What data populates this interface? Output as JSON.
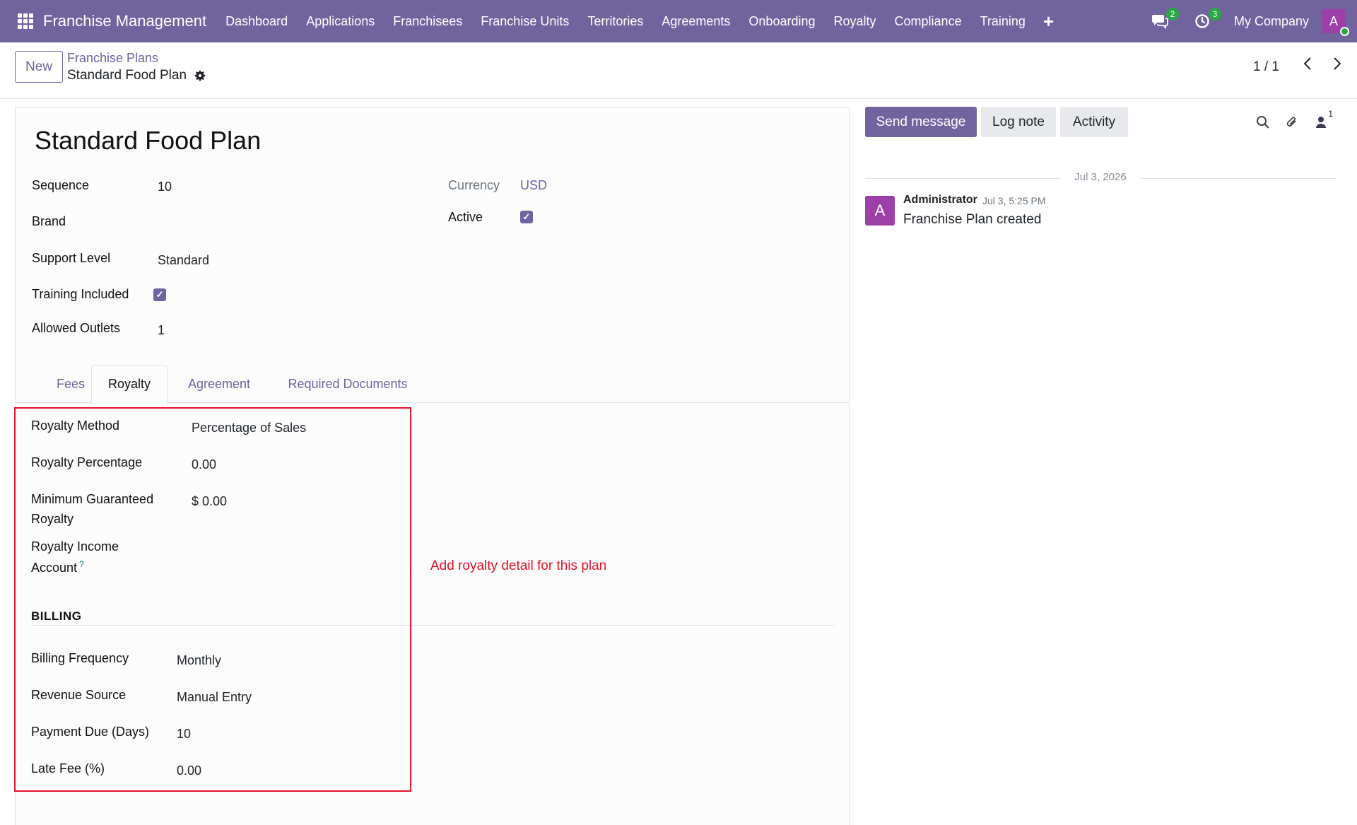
{
  "navbar": {
    "brand": "Franchise Management",
    "menu": [
      "Dashboard",
      "Applications",
      "Franchisees",
      "Franchise Units",
      "Territories",
      "Agreements",
      "Onboarding",
      "Royalty",
      "Compliance",
      "Training"
    ],
    "messages_badge": "2",
    "activities_badge": "3",
    "company": "My Company",
    "avatar_letter": "A",
    "color": "#71639e"
  },
  "control": {
    "new_button": "New",
    "breadcrumb_parent": "Franchise Plans",
    "breadcrumb_current": "Standard Food Plan",
    "pager": "1 / 1"
  },
  "form": {
    "title": "Standard Food Plan",
    "fields": {
      "sequence_label": "Sequence",
      "sequence_value": "10",
      "brand_label": "Brand",
      "support_level_label": "Support Level",
      "support_level_value": "Standard",
      "training_label": "Training Included",
      "outlets_label": "Allowed Outlets",
      "outlets_value": "1",
      "currency_label": "Currency",
      "currency_value": "USD",
      "active_label": "Active"
    },
    "tabs": [
      "Fees",
      "Royalty",
      "Agreement",
      "Required Documents"
    ],
    "active_tab": "Royalty",
    "royalty": {
      "method_label": "Royalty Method",
      "method_value": "Percentage of Sales",
      "percentage_label": "Royalty Percentage",
      "percentage_value": "0.00",
      "min_label_1": "Minimum Guaranteed",
      "min_label_2": "Royalty",
      "min_value": "$ 0.00",
      "income_label_1": "Royalty Income",
      "income_label_2": "Account",
      "income_help": "?"
    },
    "billing": {
      "section_title": "BILLING",
      "frequency_label": "Billing Frequency",
      "frequency_value": "Monthly",
      "source_label": "Revenue Source",
      "source_value": "Manual Entry",
      "due_label": "Payment Due (Days)",
      "due_value": "10",
      "late_fee_label": "Late Fee (%)",
      "late_fee_value": "0.00"
    },
    "annotation": "Add royalty detail for this plan",
    "annotation_color": "#e8102a"
  },
  "chatter": {
    "send_message": "Send message",
    "log_note": "Log note",
    "activity": "Activity",
    "followers_count": "1",
    "date": "Jul 3, 2026",
    "message": {
      "avatar_letter": "A",
      "author": "Administrator",
      "time": "Jul 3, 5:25 PM",
      "body": "Franchise Plan created"
    }
  }
}
